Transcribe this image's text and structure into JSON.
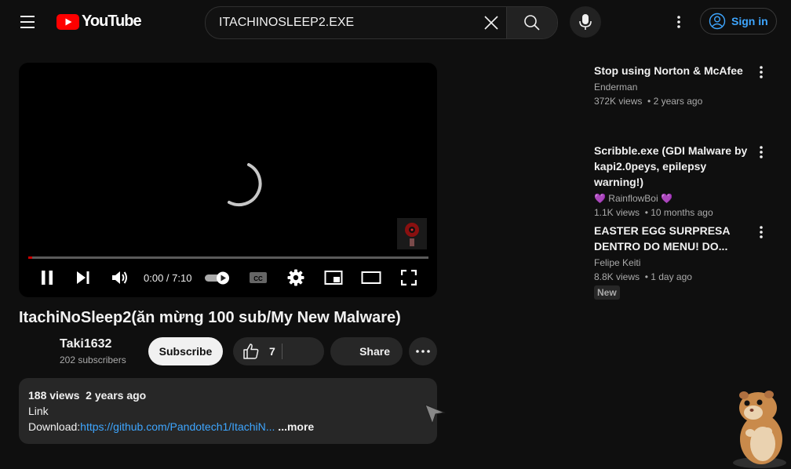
{
  "header": {
    "logo_text": "YouTube",
    "search_value": "ITACHINOSLEEP2.EXE",
    "signin_label": "Sign in"
  },
  "player": {
    "time": "0:00 / 7:10",
    "progress": 0.01,
    "autoplay": true
  },
  "video": {
    "title": "ItachiNoSleep2(ăn mừng 100 sub/My New Malware)",
    "channel": "Taki1632",
    "subscribers": "202 subscribers",
    "subscribe_label": "Subscribe",
    "likes": "7",
    "share_label": "Share"
  },
  "description": {
    "meta": "188 views  2 years ago",
    "line1": "Link",
    "line2_prefix": "Download:",
    "link": "https://github.com/Pandotech1/ItachiN...",
    "more": " ...more"
  },
  "recommendations": [
    {
      "title": "Stop using Norton & McAfee",
      "channel": "Enderman",
      "meta": "372K views  • 2 years ago"
    },
    {
      "title": "Scribble.exe (GDI Malware by kapi2.0peys, epilepsy warning!)",
      "channel": "💜 RainflowBoi 💜",
      "meta": "1.1K views  • 10 months ago"
    },
    {
      "title": "EASTER EGG SURPRESA DENTRO DO MENU! DO...",
      "channel": "Felipe Keiti",
      "meta": "8.8K views  • 1 day ago",
      "badge": "New"
    }
  ],
  "colors": {
    "accent": "#3ea6ff",
    "brand": "#ff0000",
    "background": "#0f0f0f"
  }
}
